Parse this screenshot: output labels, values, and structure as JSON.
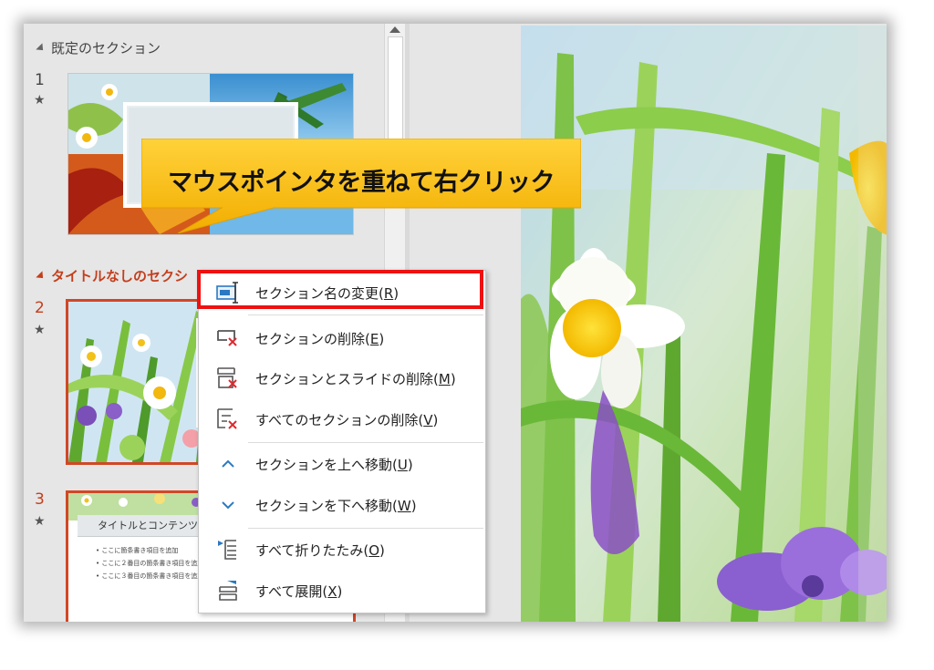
{
  "sections": [
    {
      "label": "既定のセクション",
      "collapsed": false
    },
    {
      "label": "タイトルなしのセクシ",
      "collapsed": false
    }
  ],
  "slides": [
    {
      "number": "1",
      "star": "★"
    },
    {
      "number": "2",
      "star": "★"
    },
    {
      "number": "3",
      "star": "★"
    }
  ],
  "slide3_preview": {
    "title": "タイトルとコンテンツ",
    "bullets": [
      "• ここに箇条書き項目を追加",
      "• ここに２番目の箇条書き項目を追加",
      "• ここに３番目の箇条書き項目を追加"
    ]
  },
  "callout": {
    "text": "マウスポインタを重ねて右クリック"
  },
  "context_menu": [
    {
      "label": "セクション名の変更(",
      "key": "R",
      "suffix": ")",
      "icon": "rename-section-icon",
      "highlighted": true
    },
    {
      "label": "セクションの削除(",
      "key": "E",
      "suffix": ")",
      "icon": "remove-section-icon"
    },
    {
      "label": "セクションとスライドの削除(",
      "key": "M",
      "suffix": ")",
      "icon": "remove-section-and-slides-icon"
    },
    {
      "label": "すべてのセクションの削除(",
      "key": "V",
      "suffix": ")",
      "icon": "remove-all-sections-icon"
    },
    {
      "label": "セクションを上へ移動(",
      "key": "U",
      "suffix": ")",
      "icon": "move-up-icon"
    },
    {
      "label": "セクションを下へ移動(",
      "key": "W",
      "suffix": ")",
      "icon": "move-down-icon"
    },
    {
      "label": "すべて折りたたみ(",
      "key": "O",
      "suffix": ")",
      "icon": "collapse-all-icon"
    },
    {
      "label": "すべて展開(",
      "key": "X",
      "suffix": ")",
      "icon": "expand-all-icon"
    }
  ],
  "colors": {
    "accent": "#d24726",
    "highlight_box": "#ee1111",
    "callout": "#f7b800",
    "menu_icon_blue": "#2b79c2",
    "menu_icon_red": "#e0262c"
  }
}
